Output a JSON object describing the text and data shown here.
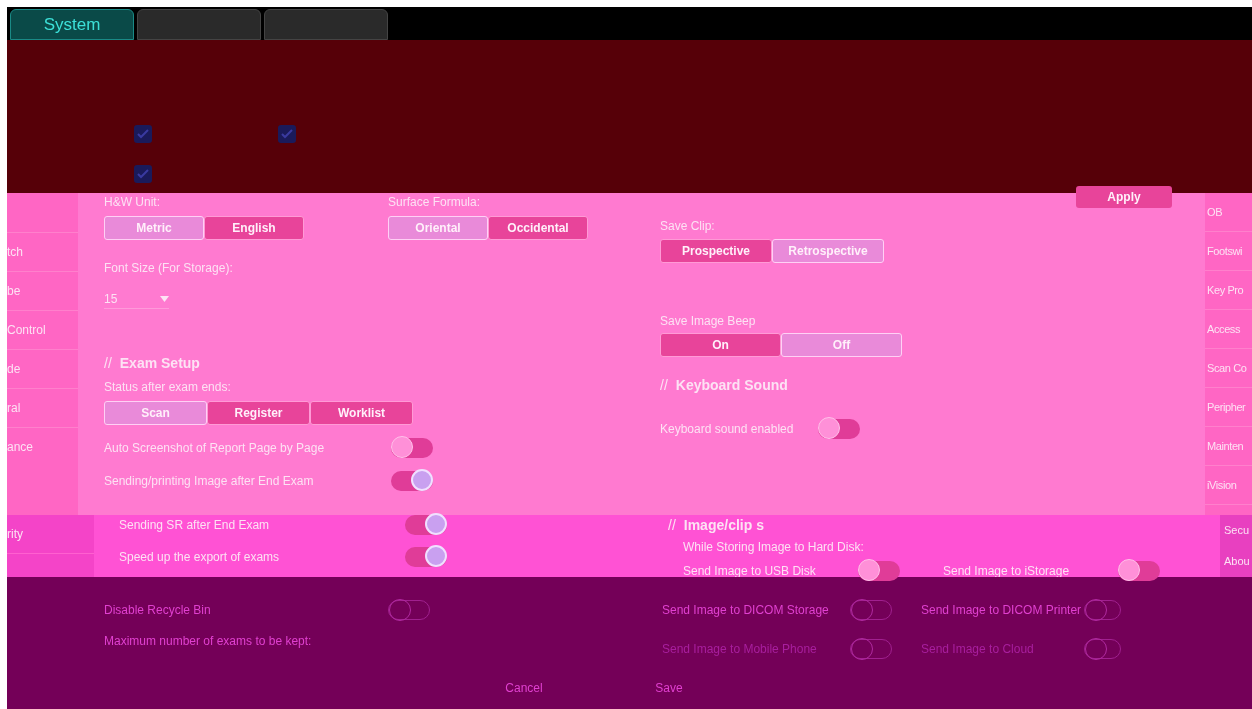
{
  "tabs": [
    {
      "label": "System",
      "selected": true
    },
    {
      "selected": false
    },
    {
      "selected": false
    }
  ],
  "top_panel": {
    "checkboxes": [
      {
        "checked": true
      },
      {
        "checked": true
      },
      {
        "checked": true
      }
    ],
    "apply_button": "Apply"
  },
  "left_sidebar": {
    "items": [
      "tch",
      "be",
      "Control",
      "de",
      "ral",
      "ance"
    ],
    "items_lower": [
      "rity"
    ]
  },
  "general": {
    "hw_unit": {
      "label": "H&W Unit:",
      "options": [
        {
          "label": "Metric",
          "selected": true
        },
        {
          "label": "English",
          "selected": false
        }
      ]
    },
    "surface_formula": {
      "label": "Surface Formula:",
      "options": [
        {
          "label": "Oriental",
          "selected": true
        },
        {
          "label": "Occidental",
          "selected": false
        }
      ]
    },
    "font_size": {
      "label": "Font Size (For Storage):",
      "value": "15"
    }
  },
  "exam_setup": {
    "prefix": "//",
    "title": "Exam Setup",
    "status_after_exam": {
      "label": "Status after exam ends:",
      "options": [
        {
          "label": "Scan",
          "selected": true
        },
        {
          "label": "Register",
          "selected": false
        },
        {
          "label": "Worklist",
          "selected": false
        }
      ]
    },
    "toggles": [
      {
        "label": "Auto Screenshot of Report Page by Page",
        "on": false
      },
      {
        "label": "Sending/printing Image after End Exam",
        "on": true
      }
    ],
    "toggles_lower": [
      {
        "label": "Sending SR after End Exam",
        "on": true
      },
      {
        "label": "Speed up the export of exams",
        "on": true
      }
    ],
    "toggles_bottom": [
      {
        "label": "Disable Recycle Bin",
        "on": false
      }
    ],
    "max_exams_label": "Maximum number of exams to be kept:"
  },
  "save": {
    "save_clip": {
      "label": "Save Clip:",
      "options": [
        {
          "label": "Prospective",
          "selected": false
        },
        {
          "label": "Retrospective",
          "selected": true
        }
      ]
    },
    "save_image_beep": {
      "label": "Save Image Beep",
      "options": [
        {
          "label": "On",
          "selected": false
        },
        {
          "label": "Off",
          "selected": true
        }
      ]
    }
  },
  "keyboard_sound": {
    "prefix": "//",
    "title": "Keyboard Sound",
    "toggle": {
      "label": "Keyboard sound enabled",
      "on": false
    }
  },
  "image_clip_storage": {
    "prefix": "//",
    "title": "Image/clip s",
    "subtitle": "While Storing Image to Hard Disk:",
    "rows_upper": [
      {
        "label": "Send Image to USB Disk",
        "on": false
      },
      {
        "label": "Send Image to iStorage",
        "on": false
      }
    ],
    "rows_lower": [
      {
        "label": "Send Image to DICOM Storage",
        "on": false,
        "disabled": false
      },
      {
        "label": "Send Image to DICOM Printer",
        "on": false,
        "disabled": false
      },
      {
        "label": "Send Image to Mobile Phone",
        "on": false,
        "disabled": true
      },
      {
        "label": "Send Image to Cloud",
        "on": false,
        "disabled": true
      }
    ]
  },
  "right_sidebar": {
    "items": [
      "OB",
      "Footswi",
      "Key Pro",
      "Access",
      "Scan Co",
      "Peripher",
      "Mainten",
      "iVision"
    ],
    "items_lower": [
      "Secu",
      "Abou"
    ]
  },
  "footer": {
    "cancel": "Cancel",
    "save": "Save"
  }
}
